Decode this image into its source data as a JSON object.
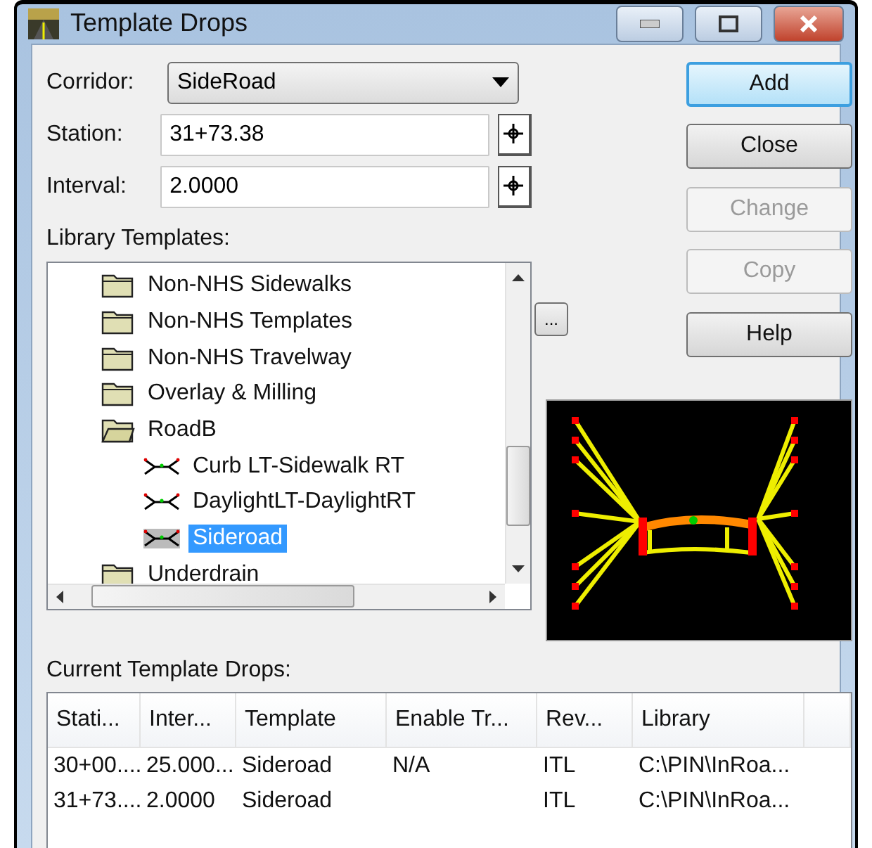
{
  "window": {
    "title": "Template Drops"
  },
  "fields": [
    {
      "label": "Corridor:",
      "value": "SideRoad",
      "kind": "dropdown"
    },
    {
      "label": "Station:",
      "value": "31+73.38",
      "kind": "pick"
    },
    {
      "label": "Interval:",
      "value": "2.0000",
      "kind": "pick"
    }
  ],
  "library": {
    "label": "Library Templates:",
    "items": [
      {
        "label": "Non-NHS Sidewalks",
        "kind": "folder",
        "expanded": false,
        "selected": false
      },
      {
        "label": "Non-NHS Templates",
        "kind": "folder",
        "expanded": false,
        "selected": false
      },
      {
        "label": "Non-NHS Travelway",
        "kind": "folder",
        "expanded": false,
        "selected": false
      },
      {
        "label": "Overlay & Milling",
        "kind": "folder",
        "expanded": false,
        "selected": false
      },
      {
        "label": "RoadB",
        "kind": "folder",
        "expanded": true,
        "selected": false,
        "children": [
          {
            "label": "Curb LT-Sidewalk RT",
            "kind": "template",
            "selected": false
          },
          {
            "label": "DaylightLT-DaylightRT",
            "kind": "template",
            "selected": false
          },
          {
            "label": "Sideroad",
            "kind": "template",
            "selected": true
          }
        ]
      },
      {
        "label": "Underdrain",
        "kind": "folder",
        "expanded": false,
        "selected": false
      }
    ],
    "browse_button": "..."
  },
  "buttons": [
    {
      "label": "Add",
      "disabled": false,
      "default": true
    },
    {
      "label": "Close",
      "disabled": false,
      "default": false
    },
    {
      "label": "Change",
      "disabled": true,
      "default": false
    },
    {
      "label": "Copy",
      "disabled": true,
      "default": false
    },
    {
      "label": "Help",
      "disabled": false,
      "default": false
    }
  ],
  "drops": {
    "label": "Current Template Drops:",
    "columns": [
      "Stati...",
      "Inter...",
      "Template",
      "Enable Tr...",
      "Rev...",
      "Library"
    ],
    "rows": [
      [
        "30+00....",
        "25.000...",
        "Sideroad",
        "N/A",
        "ITL",
        "C:\\PIN\\InRoa..."
      ],
      [
        "31+73....",
        "2.0000",
        "Sideroad",
        "",
        "ITL",
        "C:\\PIN\\InRoa..."
      ]
    ]
  }
}
